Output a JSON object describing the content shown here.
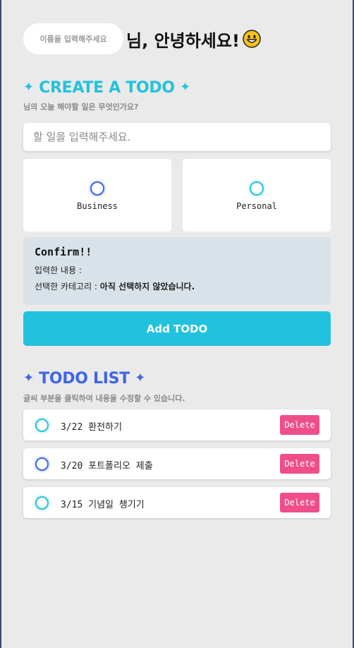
{
  "greeting": {
    "name_placeholder": "이름을 입력해주세요",
    "text": "님, 안녕하세요!",
    "emoji_icon": "grinning-face-icon"
  },
  "create": {
    "sparkle_left": "✦",
    "title": "CREATE A TODO",
    "sparkle_right": "✦",
    "subtitle": "님의 오늘 해야할 일은 무엇인가요?",
    "input_placeholder": "할 일을 입력해주세요.",
    "categories": [
      {
        "label": "Business",
        "color": "#3f64e6"
      },
      {
        "label": "Personal",
        "color": "#22c2de"
      }
    ]
  },
  "confirm": {
    "title": "Confirm!!",
    "input_label": "입력한 내용 :",
    "input_value": "",
    "category_label": "선택한 카테고리 :",
    "category_value": "아직 선택하지 않았습니다."
  },
  "add_button": "Add TODO",
  "list": {
    "sparkle_left": "✦",
    "title": "TODO LIST",
    "sparkle_right": "✦",
    "subtitle": "글씨 부분을 클릭하여 내용을 수정할 수 있습니다.",
    "items": [
      {
        "text": "3/22 환전하기",
        "category": "Personal",
        "delete_label": "Delete"
      },
      {
        "text": "3/20 포트폴리오 제출",
        "category": "Business",
        "delete_label": "Delete"
      },
      {
        "text": "3/15 기념일 챙기기",
        "category": "Personal",
        "delete_label": "Delete"
      }
    ]
  },
  "colors": {
    "accent_cyan": "#22c2de",
    "accent_blue": "#3f64e6",
    "delete_pink": "#ef4e8a",
    "background": "#eaeaea"
  }
}
